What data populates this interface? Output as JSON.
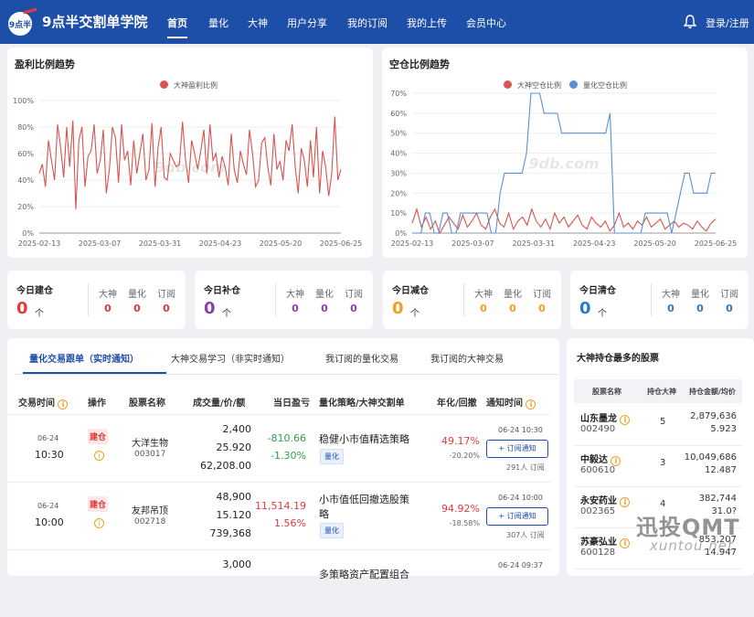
{
  "brand": {
    "name": "9点半交割单学院",
    "logo_text": "9点半"
  },
  "nav": {
    "items": [
      "首页",
      "量化",
      "大神",
      "用户分享",
      "我的订阅",
      "我的上传",
      "会员中心"
    ],
    "login": "登录/注册"
  },
  "profit_chart": {
    "title": "盈利比例趋势",
    "watermark": "9db.com",
    "chart_data": {
      "type": "line",
      "x_ticks": [
        "2025-02-13",
        "2025-03-07",
        "2025-03-31",
        "2025-04-23",
        "2025-05-20",
        "2025-06-25"
      ],
      "y_ticks": [
        "0%",
        "20%",
        "40%",
        "60%",
        "80%",
        "100%"
      ],
      "ylim": [
        0,
        100
      ],
      "series": [
        {
          "name": "大神盈利比例",
          "color": "#d9534f",
          "values": [
            45,
            52,
            35,
            70,
            55,
            40,
            82,
            65,
            42,
            80,
            50,
            85,
            18,
            70,
            80,
            35,
            58,
            62,
            82,
            45,
            55,
            78,
            30,
            48,
            80,
            72,
            38,
            82,
            55,
            62,
            36,
            70,
            45,
            60,
            75,
            40,
            48,
            83,
            35,
            65,
            80,
            42,
            40,
            60,
            55,
            50,
            52,
            84,
            55,
            38,
            70,
            60,
            48,
            62,
            78,
            45,
            82,
            55,
            60,
            42,
            58,
            50,
            36,
            75,
            48,
            38,
            62,
            52,
            44,
            78,
            60,
            35,
            40,
            68,
            72,
            50,
            36,
            75,
            48,
            54,
            40,
            70,
            62,
            82,
            50,
            30,
            64,
            55,
            35,
            70,
            42,
            80,
            30,
            62,
            50,
            28,
            45,
            88,
            40,
            48
          ]
        }
      ]
    }
  },
  "empty_chart": {
    "title": "空仓比例趋势",
    "watermark": "9db.com",
    "chart_data": {
      "type": "line",
      "x_ticks": [
        "2025-02-13",
        "2025-03-07",
        "2025-03-31",
        "2025-04-23",
        "2025-05-20",
        "2025-06-25"
      ],
      "y_ticks": [
        "0%",
        "10%",
        "20%",
        "30%",
        "40%",
        "50%",
        "60%",
        "70%"
      ],
      "ylim": [
        0,
        70
      ],
      "series": [
        {
          "name": "大神空仓比例",
          "color": "#d9534f",
          "values": [
            5,
            12,
            3,
            8,
            2,
            6,
            0,
            4,
            8,
            5,
            2,
            9,
            3,
            6,
            10,
            4,
            2,
            8,
            12,
            5,
            3,
            10,
            2,
            6,
            8,
            4,
            12,
            6,
            3,
            7,
            2,
            10,
            5,
            8,
            3,
            6,
            9,
            4,
            2,
            8,
            5,
            3,
            6,
            1,
            4,
            10,
            3,
            5,
            2,
            6,
            4,
            8,
            3,
            5,
            7,
            2,
            4,
            6,
            3,
            5,
            4,
            2,
            6,
            3,
            1,
            5,
            7
          ]
        },
        {
          "name": "量化空仓比例",
          "color": "#5b8fd6",
          "values": [
            0,
            0,
            0,
            10,
            10,
            0,
            0,
            10,
            10,
            0,
            0,
            10,
            10,
            10,
            10,
            10,
            10,
            10,
            0,
            0,
            20,
            30,
            30,
            30,
            30,
            30,
            40,
            70,
            70,
            70,
            60,
            60,
            60,
            60,
            50,
            50,
            50,
            50,
            50,
            50,
            50,
            50,
            50,
            50,
            50,
            60,
            0,
            0,
            0,
            0,
            0,
            0,
            0,
            10,
            10,
            10,
            10,
            10,
            10,
            0,
            10,
            20,
            30,
            30,
            20,
            20,
            20,
            20,
            30,
            30
          ]
        }
      ]
    }
  },
  "stats": [
    {
      "label": "今日建仓",
      "total": "0",
      "unit": "个",
      "color": "#e03a3a",
      "heads": [
        "大神",
        "量化",
        "订阅"
      ],
      "values": [
        "0",
        "0",
        "0"
      ]
    },
    {
      "label": "今日补仓",
      "total": "0",
      "unit": "个",
      "color": "#8e3fa8",
      "heads": [
        "大神",
        "量化",
        "订阅"
      ],
      "values": [
        "0",
        "0",
        "0"
      ]
    },
    {
      "label": "今日减仓",
      "total": "0",
      "unit": "个",
      "color": "#f0a020",
      "heads": [
        "大神",
        "量化",
        "订阅"
      ],
      "values": [
        "0",
        "0",
        "0"
      ]
    },
    {
      "label": "今日清仓",
      "total": "0",
      "unit": "个",
      "color": "#2d79c7",
      "heads": [
        "大神",
        "量化",
        "订阅"
      ],
      "values": [
        "0",
        "0",
        "0"
      ]
    }
  ],
  "trades": {
    "tabs": [
      "量化交易跟单（实时通知）",
      "大神交易学习（非实时通知）",
      "我订阅的量化交易",
      "我订阅的大神交易"
    ],
    "headers": [
      "交易时间",
      "操作",
      "股票名称",
      "成交量/价/额",
      "当日盈亏",
      "量化策略/大神交割单",
      "年化/回撤",
      "通知时间"
    ],
    "rows": [
      {
        "date": "06-24",
        "time": "10:30",
        "op": "建仓",
        "name": "大洋生物",
        "code": "003017",
        "vol": "2,400",
        "price": "25.920",
        "amount": "62,208.00",
        "pnl": "-810.66",
        "pnl_pct": "-1.30%",
        "pnl_color": "#2e9c4e",
        "strategy": "稳健小市值精选策略",
        "strategy2": "",
        "tag": "量化",
        "annual": "49.17%",
        "drawdown": "-20.20%",
        "notify": "06-24 10:30",
        "btn": "+ 订阅通知",
        "subs": "291人 订阅"
      },
      {
        "date": "06-24",
        "time": "10:00",
        "op": "建仓",
        "name": "友邦吊顶",
        "code": "002718",
        "vol": "48,900",
        "price": "15.120",
        "amount": "739,368",
        "pnl": "11,514.19",
        "pnl_pct": "1.56%",
        "pnl_color": "#e03a3a",
        "strategy": "小市值低回撤选股策",
        "strategy2": "略",
        "tag": "量化",
        "annual": "94.92%",
        "drawdown": "-18.58%",
        "notify": "06-24 10:00",
        "btn": "+ 订阅通知",
        "subs": "307人 订阅"
      },
      {
        "date": "",
        "time": "",
        "op": "",
        "name": "",
        "code": "",
        "vol": "3,000",
        "price": "",
        "amount": "",
        "pnl": "",
        "pnl_pct": "",
        "pnl_color": "#e03a3a",
        "strategy": "多策略资产配置组合",
        "strategy2": "",
        "tag": "",
        "annual": "",
        "drawdown": "",
        "notify": "06-24 09:37",
        "btn": "",
        "subs": ""
      }
    ]
  },
  "holdings": {
    "title": "大神持仓最多的股票",
    "headers": [
      "股票名称",
      "持仓大神",
      "持仓金额/均价"
    ],
    "rows": [
      {
        "name": "山东墨龙",
        "code": "002490",
        "count": "5",
        "amount": "2,879,636",
        "avg": "5.923"
      },
      {
        "name": "中毅达",
        "code": "600610",
        "count": "3",
        "amount": "10,049,686",
        "avg": "12.487"
      },
      {
        "name": "永安药业",
        "code": "002365",
        "count": "4",
        "amount": "382,744",
        "avg": "31.0?"
      },
      {
        "name": "苏豪弘业",
        "code": "600128",
        "count": "",
        "amount": "853,207",
        "avg": "14.947"
      }
    ]
  },
  "watermark": {
    "main": "迅投QMT",
    "sub": "xuntou.net"
  }
}
